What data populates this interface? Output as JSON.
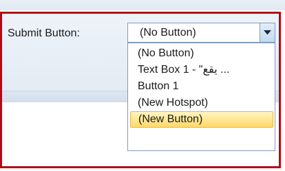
{
  "form": {
    "submit_label": "Submit Button:"
  },
  "combo": {
    "selected_value": "(No Button)",
    "arrow_icon": "chevron-down-icon",
    "options": [
      "(No Button)",
      "Text Box 1 - \"يقع ...",
      "Button 1",
      "(New Hotspot)",
      "(New Button)"
    ],
    "highlighted_index": 4
  },
  "colors": {
    "highlight_frame": "#b20a18",
    "selected_item": "#ffe792",
    "combo_border": "#7f9db9"
  }
}
